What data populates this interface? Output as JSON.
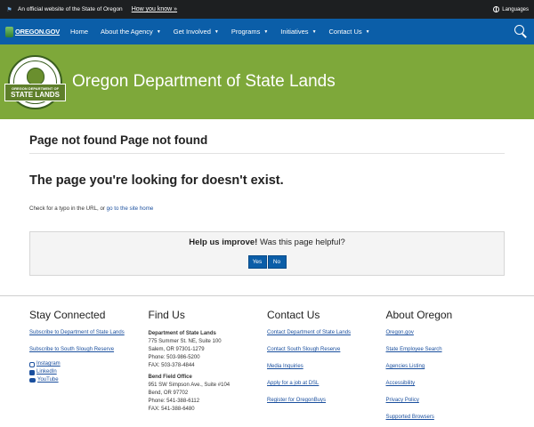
{
  "topbar": {
    "official_text": "An official website of the State of Oregon",
    "how_you_know": "How you know »",
    "languages": "Languages"
  },
  "nav": {
    "logo_text": "OREGON.GOV",
    "items": [
      {
        "label": "Home"
      },
      {
        "label": "About the Agency"
      },
      {
        "label": "Get Involved"
      },
      {
        "label": "Programs"
      },
      {
        "label": "Initiatives"
      },
      {
        "label": "Contact Us"
      }
    ]
  },
  "banner": {
    "seal_top": "STATE OF OREGON",
    "seal_line1": "OREGON DEPARTMENT OF",
    "seal_line2": "STATE LANDS",
    "title": "Oregon Department of State Lands"
  },
  "main": {
    "page_title": "Page not found Page not found",
    "subhead": "The page you're looking for doesn't exist.",
    "hint_prefix": "Check for a typo in the URL, or ",
    "hint_link": "go to the site home"
  },
  "feedback": {
    "bold": "Help us improve!",
    "question": "Was this page helpful?",
    "yes": "Yes",
    "no": "No"
  },
  "footer": {
    "stay_connected": {
      "title": "Stay Connected",
      "links": [
        "Subscribe to Department of State Lands",
        "Subscribe to South Slough Reserve"
      ],
      "social": [
        "Instagram",
        "LinkedIn",
        "YouTube"
      ]
    },
    "find_us": {
      "title": "Find Us",
      "office1": {
        "name": "Department of State Lands",
        "line1": "775 Summer St. NE, Suite 100",
        "line2": "Salem, OR 97301-1279",
        "phone": "Phone: 503-986-5200",
        "fax": "FAX: 503-378-4844"
      },
      "office2": {
        "name": "Bend Field Office",
        "line1": "951 SW Simpson Ave., Suite #104",
        "line2": "Bend, OR 97702",
        "phone": "Phone: 541-388-6112",
        "fax": "FAX: 541-388-6480"
      }
    },
    "contact_us": {
      "title": "Contact Us",
      "links": [
        "Contact Department of State Lands",
        "Contact South Slough Reserve",
        "Media Inquiries",
        "Apply for a job at DSL",
        "Register for OregonBuys"
      ]
    },
    "about_oregon": {
      "title": "About Oregon",
      "links": [
        "Oregon.gov",
        "State Employee Search",
        "Agencies Listing",
        "Accessibility",
        "Privacy Policy",
        "Supported Browsers"
      ]
    }
  }
}
